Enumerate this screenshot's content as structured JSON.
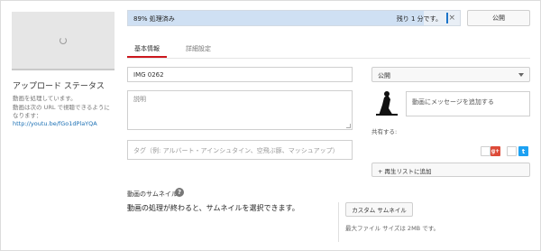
{
  "upload": {
    "status_title": "アップロード ステータス",
    "status_line1": "動画を処理しています。",
    "status_line2": "動画は次の URL で視聴できるように",
    "status_line3": "なります：",
    "video_url": "http://youtu.be/fGo1dPlaYQA"
  },
  "progress": {
    "label": "89% 処理済み",
    "percent": 89,
    "remaining": "残り 1 分です。",
    "close_symbol": "×"
  },
  "header": {
    "publish_label": "公開"
  },
  "tabs": [
    {
      "label": "基本情報"
    },
    {
      "label": "詳細設定"
    }
  ],
  "fields": {
    "title_value": "IMG 0262",
    "description_placeholder": "説明",
    "tags_placeholder": "タグ（例: アルバート・アインシュタイン、空飛ぶ豚、マッシュアップ）"
  },
  "visibility": {
    "selected": "公開"
  },
  "share": {
    "message_placeholder": "動画にメッセージを追加する",
    "share_label": "共有する:",
    "gplus_text": "g+",
    "twitter_text": "t"
  },
  "playlist": {
    "add_label": "+ 再生リストに追加"
  },
  "thumbnail": {
    "heading": "動画のサムネイル",
    "help_symbol": "?",
    "message": "動画の処理が終わると、サムネイルを選択できます。",
    "custom_button": "カスタム サムネイル",
    "max_size": "最大ファイル サイズは 2MB です。"
  },
  "colors": {
    "accent_red": "#cc181e",
    "progress_blue": "#1a73c8",
    "link_blue": "#1a6fb4",
    "gplus": "#dd4b39",
    "twitter": "#1da1f2"
  }
}
